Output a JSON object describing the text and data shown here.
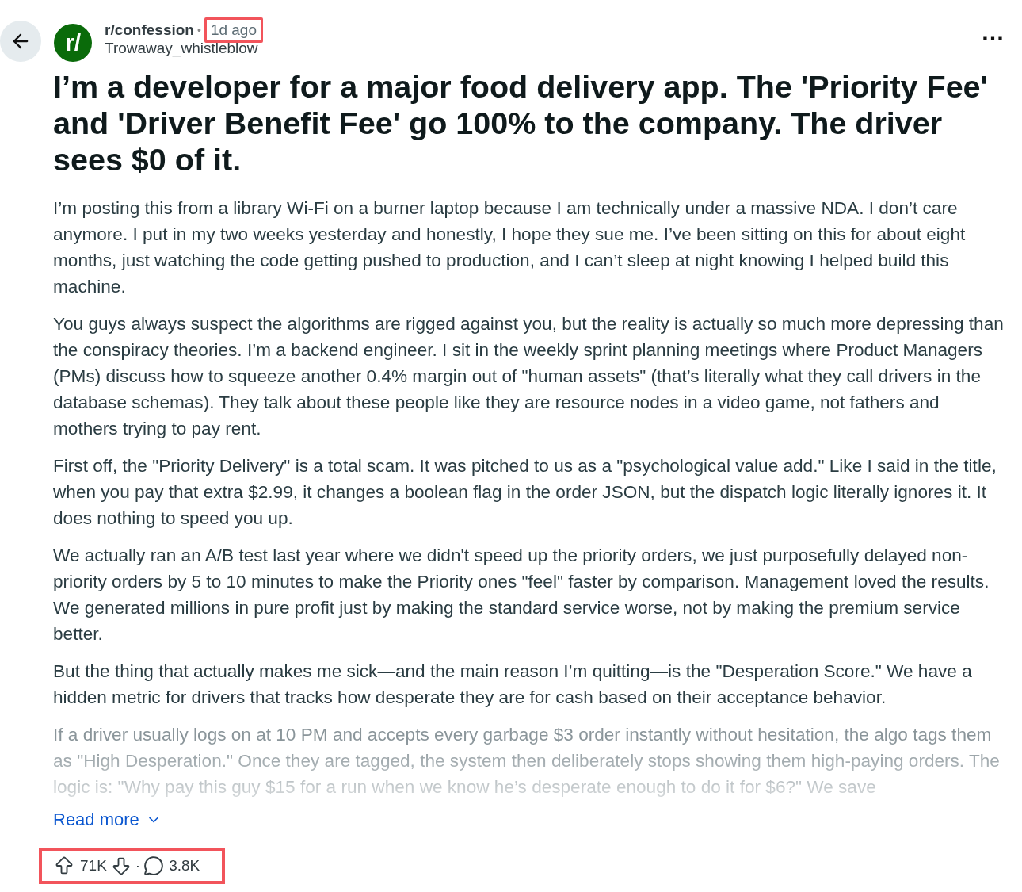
{
  "post": {
    "community": "r/confession",
    "avatar_text": "r/",
    "separator": "•",
    "time": "1d ago",
    "time_highlighted": true,
    "author": "Trowaway_whistleblow",
    "menu": "…",
    "title": "I’m a developer for a major food delivery app. The 'Priority Fee' and 'Driver Benefit Fee' go 100% to the company. The driver sees $0 of it.",
    "paragraphs": [
      {
        "text": "I’m posting this from a library Wi-Fi on a burner laptop because I am technically under a massive NDA. I don’t care anymore. I put in my two weeks yesterday and honestly, I hope they sue me. I’ve been sitting on this for about eight months, just watching the code getting pushed to production, and I can’t sleep at night knowing I helped build this machine.",
        "faded": false
      },
      {
        "text": "You guys always suspect the algorithms are rigged against you, but the reality is actually so much more depressing than the conspiracy theories. I’m a backend engineer. I sit in the weekly sprint planning meetings where Product Managers (PMs) discuss how to squeeze another 0.4% margin out of \"human assets\" (that’s literally what they call drivers in the database schemas). They talk about these people like they are resource nodes in a video game, not fathers and mothers trying to pay rent.",
        "faded": false
      },
      {
        "text": "First off, the \"Priority Delivery\" is a total scam. It was pitched to us as a \"psychological value add.\" Like I said in the title, when you pay that extra $2.99, it changes a boolean flag in the order JSON, but the dispatch logic literally ignores it. It does nothing to speed you up.",
        "faded": false
      },
      {
        "text": "We actually ran an A/B test last year where we didn't speed up the priority orders, we just purposefully delayed non-priority orders by 5 to 10 minutes to make the Priority ones \"feel\" faster by comparison. Management loved the results. We generated millions in pure profit just by making the standard service worse, not by making the premium service better.",
        "faded": false
      },
      {
        "text": "But the thing that actually makes me sick—and the main reason I’m quitting—is the \"Desperation Score.\" We have a hidden metric for drivers that tracks how desperate they are for cash based on their acceptance behavior.",
        "faded": false
      },
      {
        "text": "If a driver usually logs on at 10 PM and accepts every garbage $3 order instantly without hesitation, the algo tags them as \"High Desperation.\" Once they are tagged, the system then deliberately stops showing them high-paying orders. The logic is: \"Why pay this guy $15 for a run when we know he’s desperate enough to do it for $6?\" We save",
        "faded": true
      }
    ],
    "read_more": "Read more",
    "upvotes": "71K",
    "dot": "·",
    "comments": "3.8K",
    "stats_highlighted": true
  }
}
